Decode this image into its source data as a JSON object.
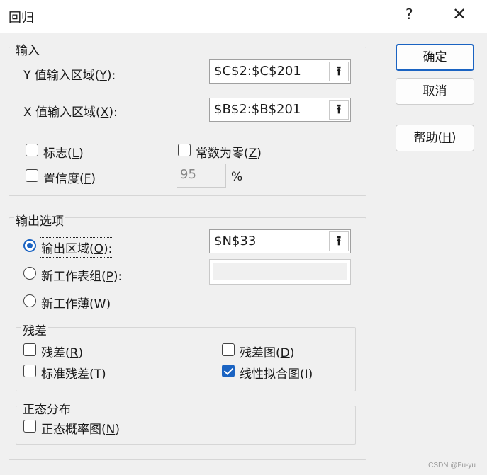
{
  "window": {
    "title": "回归",
    "help_glyph": "?",
    "close_glyph": "✕"
  },
  "input_group": {
    "legend": "输入",
    "y_range": {
      "label_prefix": "Y 值输入区域(",
      "label_key": "Y",
      "label_suffix": "):",
      "value": "$C$2:$C$201"
    },
    "x_range": {
      "label_prefix": "X 值输入区域(",
      "label_key": "X",
      "label_suffix": "):",
      "value": "$B$2:$B$201"
    },
    "labels_checkbox": {
      "label_prefix": "标志(",
      "label_key": "L",
      "label_suffix": ")",
      "checked": false
    },
    "constant_zero_checkbox": {
      "label_prefix": "常数为零(",
      "label_key": "Z",
      "label_suffix": ")",
      "checked": false
    },
    "confidence_checkbox": {
      "label_prefix": "置信度(",
      "label_key": "F",
      "label_suffix": ")",
      "checked": false
    },
    "confidence_value": "95",
    "percent_sign": "%"
  },
  "output_group": {
    "legend": "输出选项",
    "output_range": {
      "label_prefix": "输出区域(",
      "label_key": "O",
      "label_suffix": "):",
      "value": "$N$33",
      "selected": true
    },
    "new_worksheet": {
      "label_prefix": "新工作表组(",
      "label_key": "P",
      "label_suffix": "):",
      "value": "",
      "selected": false
    },
    "new_workbook": {
      "label_prefix": "新工作薄(",
      "label_key": "W",
      "label_suffix": ")",
      "selected": false
    }
  },
  "residuals_group": {
    "legend": "残差",
    "residuals": {
      "label_prefix": "残差(",
      "label_key": "R",
      "label_suffix": ")",
      "checked": false
    },
    "residual_plots": {
      "label_prefix": "残差图(",
      "label_key": "D",
      "label_suffix": ")",
      "checked": false
    },
    "standardized_residuals": {
      "label_prefix": "标准残差(",
      "label_key": "T",
      "label_suffix": ")",
      "checked": false
    },
    "line_fit_plots": {
      "label_prefix": "线性拟合图(",
      "label_key": "I",
      "label_suffix": ")",
      "checked": true
    }
  },
  "normal_group": {
    "legend": "正态分布",
    "normal_probability_plots": {
      "label_prefix": "正态概率图(",
      "label_key": "N",
      "label_suffix": ")",
      "checked": false
    }
  },
  "buttons": {
    "ok": "确定",
    "cancel": "取消",
    "help_prefix": "帮助(",
    "help_key": "H",
    "help_suffix": ")"
  },
  "icons": {
    "collapse": "collapse-dialog-icon",
    "accent_color": "#1a63c2"
  },
  "watermark": "CSDN @Fu-yu"
}
